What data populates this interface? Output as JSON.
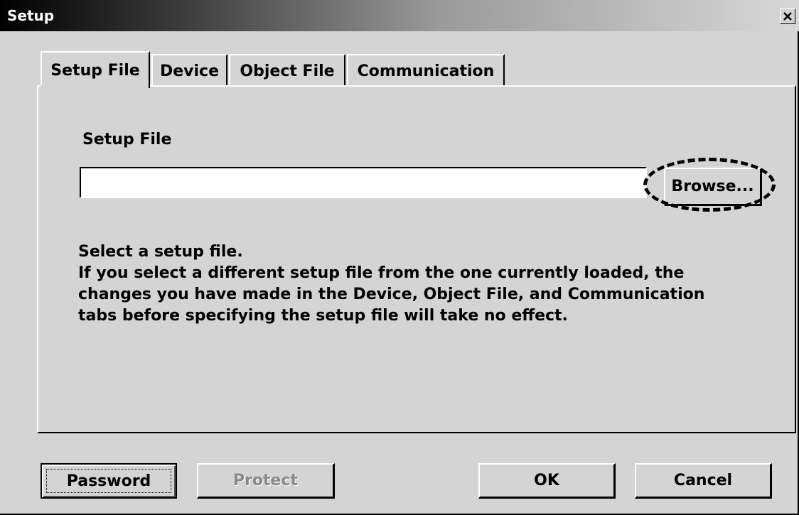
{
  "window": {
    "title": "Setup",
    "close_glyph": "✕"
  },
  "tabs": [
    {
      "label": "Setup File",
      "active": true
    },
    {
      "label": "Device",
      "active": false
    },
    {
      "label": "Object File",
      "active": false
    },
    {
      "label": "Communication",
      "active": false
    }
  ],
  "panel": {
    "section_label": "Setup File",
    "file_input_value": "",
    "browse_label": "Browse...",
    "description_lines": [
      "Select a setup file.",
      "If you select a different setup file from the one currently loaded, the",
      "changes you have made in the Device, Object File, and Communication",
      "tabs before specifying the setup file will take no effect."
    ]
  },
  "buttons": {
    "password": "Password",
    "protect": "Protect",
    "ok": "OK",
    "cancel": "Cancel"
  },
  "colors": {
    "face": "#d4d4d4",
    "disabled_text": "#8a8a8a"
  }
}
